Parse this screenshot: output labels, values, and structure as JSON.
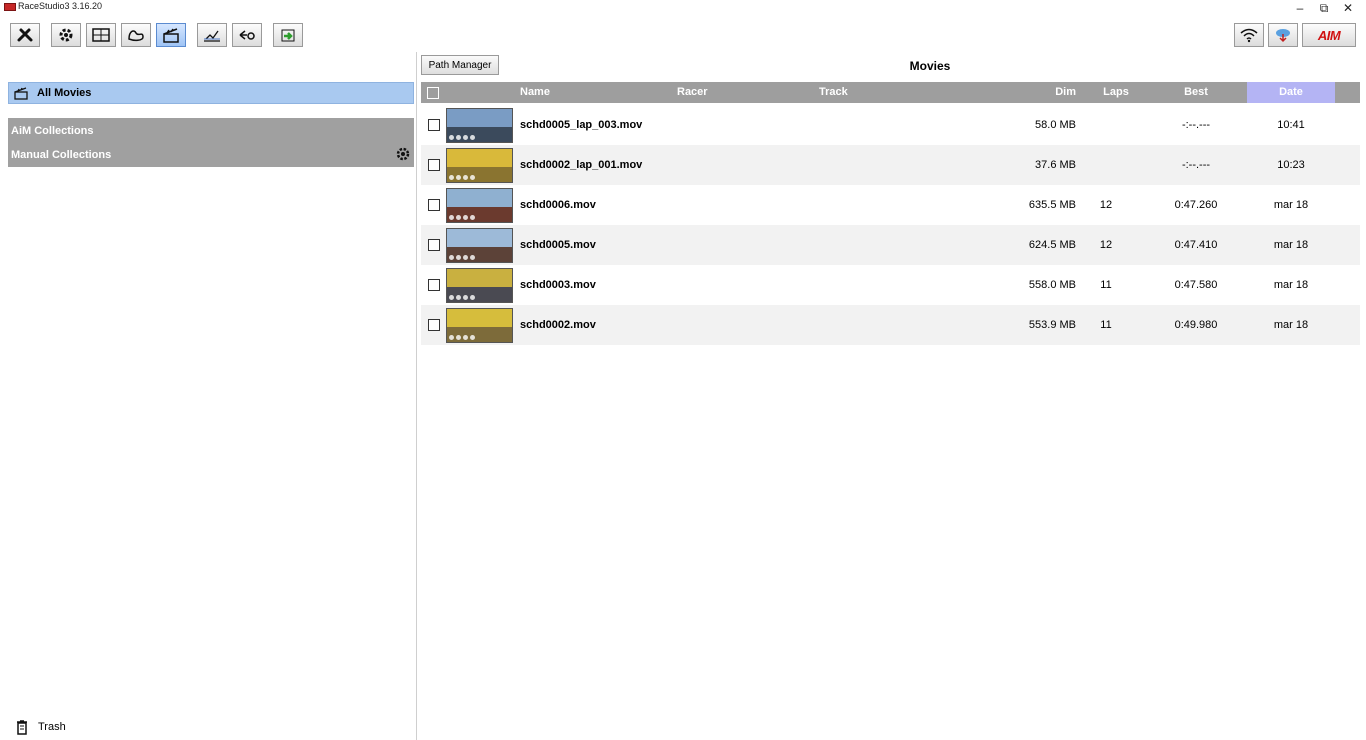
{
  "window": {
    "title": "RaceStudio3 3.16.20",
    "controls": [
      "–",
      "⧉",
      "✕"
    ]
  },
  "toolbar": {
    "buttons": [
      {
        "icon": "tools-icon",
        "active": false
      },
      {
        "icon": "engine-gear-icon",
        "active": false
      },
      {
        "icon": "dashboard-icon",
        "active": false
      },
      {
        "icon": "track-map-icon",
        "active": false
      },
      {
        "icon": "movie-clapper-icon",
        "active": true
      },
      {
        "icon": "analysis-chart-icon",
        "active": false
      },
      {
        "icon": "transfer-icon",
        "active": false
      },
      {
        "icon": "export-arrow-icon",
        "active": false
      }
    ],
    "right": [
      {
        "icon": "wifi-icon"
      },
      {
        "icon": "cloud-download-icon"
      },
      {
        "icon": "aim-logo-icon",
        "label": "AIM"
      }
    ]
  },
  "sidebar": {
    "all_movies_label": "All Movies",
    "aim_collections_label": "AiM Collections",
    "manual_collections_label": "Manual Collections",
    "trash_label": "Trash"
  },
  "main": {
    "path_manager_label": "Path Manager",
    "title": "Movies",
    "columns": {
      "name": "Name",
      "racer": "Racer",
      "track": "Track",
      "dim": "Dim",
      "laps": "Laps",
      "best": "Best",
      "date": "Date"
    },
    "rows": [
      {
        "name": "schd0005_lap_003.mov",
        "racer": "",
        "track": "",
        "dim": "58.0 MB",
        "laps": "",
        "best": "-:--.---",
        "date": "10:41",
        "thumb": {
          "sky": "#7a9cc4",
          "ground": "#3b4a5c"
        }
      },
      {
        "name": "schd0002_lap_001.mov",
        "racer": "",
        "track": "",
        "dim": "37.6 MB",
        "laps": "",
        "best": "-:--.---",
        "date": "10:23",
        "thumb": {
          "sky": "#d9b93a",
          "ground": "#8a7430"
        }
      },
      {
        "name": "schd0006.mov",
        "racer": "",
        "track": "",
        "dim": "635.5 MB",
        "laps": "12",
        "best": "0:47.260",
        "date": "mar 18",
        "thumb": {
          "sky": "#8fb0d0",
          "ground": "#6b3a2e"
        }
      },
      {
        "name": "schd0005.mov",
        "racer": "",
        "track": "",
        "dim": "624.5 MB",
        "laps": "12",
        "best": "0:47.410",
        "date": "mar 18",
        "thumb": {
          "sky": "#9dbad8",
          "ground": "#5c4238"
        }
      },
      {
        "name": "schd0003.mov",
        "racer": "",
        "track": "",
        "dim": "558.0 MB",
        "laps": "11",
        "best": "0:47.580",
        "date": "mar 18",
        "thumb": {
          "sky": "#c9b040",
          "ground": "#4a4a52"
        }
      },
      {
        "name": "schd0002.mov",
        "racer": "",
        "track": "",
        "dim": "553.9 MB",
        "laps": "11",
        "best": "0:49.980",
        "date": "mar 18",
        "thumb": {
          "sky": "#d6bd3c",
          "ground": "#7d6b3a"
        }
      }
    ]
  },
  "colors": {
    "selected": "#a9c9f0",
    "header": "#9e9e9e",
    "date_header": "#b4b4f4",
    "collection_bar": "#a0a0a0",
    "accent_red": "#d01010"
  }
}
